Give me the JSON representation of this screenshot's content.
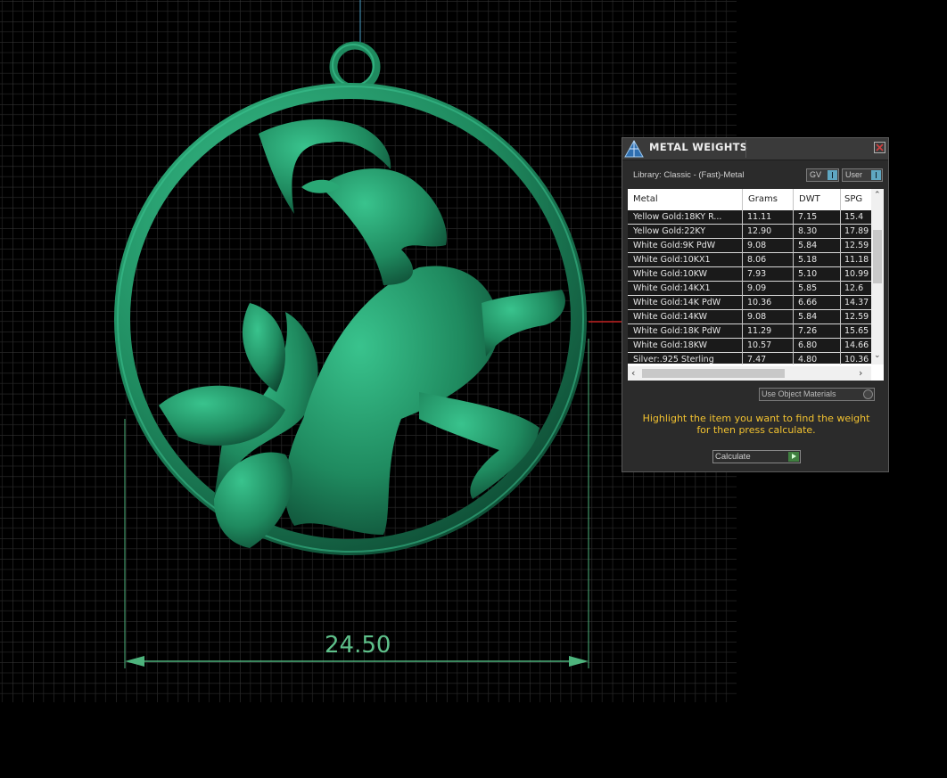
{
  "viewport": {
    "dimension_value": "24.50",
    "model_color": "#1f8a5f",
    "grid_color": "#3c3c3c"
  },
  "panel": {
    "title": "METAL WEIGHTS",
    "library_label": "Library: Classic - (Fast)-Metal",
    "toggle_gv": "GV",
    "toggle_user": "User",
    "columns": [
      "Metal",
      "Grams",
      "DWT",
      "SPG"
    ],
    "rows": [
      {
        "metal": "Yellow Gold:18KY R...",
        "grams": "11.11",
        "dwt": "7.15",
        "spg": "15.4"
      },
      {
        "metal": "Yellow Gold:22KY",
        "grams": "12.90",
        "dwt": "8.30",
        "spg": "17.89"
      },
      {
        "metal": "White Gold:9K PdW",
        "grams": "9.08",
        "dwt": "5.84",
        "spg": "12.59"
      },
      {
        "metal": "White Gold:10KX1",
        "grams": "8.06",
        "dwt": "5.18",
        "spg": "11.18"
      },
      {
        "metal": "White Gold:10KW",
        "grams": "7.93",
        "dwt": "5.10",
        "spg": "10.99"
      },
      {
        "metal": "White Gold:14KX1",
        "grams": "9.09",
        "dwt": "5.85",
        "spg": "12.6"
      },
      {
        "metal": "White Gold:14K PdW",
        "grams": "10.36",
        "dwt": "6.66",
        "spg": "14.37"
      },
      {
        "metal": "White Gold:14KW",
        "grams": "9.08",
        "dwt": "5.84",
        "spg": "12.59"
      },
      {
        "metal": "White Gold:18K PdW",
        "grams": "11.29",
        "dwt": "7.26",
        "spg": "15.65"
      },
      {
        "metal": "White Gold:18KW",
        "grams": "10.57",
        "dwt": "6.80",
        "spg": "14.66"
      },
      {
        "metal": "Silver:.925 Sterling",
        "grams": "7.47",
        "dwt": "4.80",
        "spg": "10.36"
      }
    ],
    "use_object_materials": "Use Object Materials",
    "message_line1": "Highlight the item you want to find the weight",
    "message_line2": "for then press calculate.",
    "calculate_label": "Calculate",
    "message_color": "#f2c230"
  }
}
